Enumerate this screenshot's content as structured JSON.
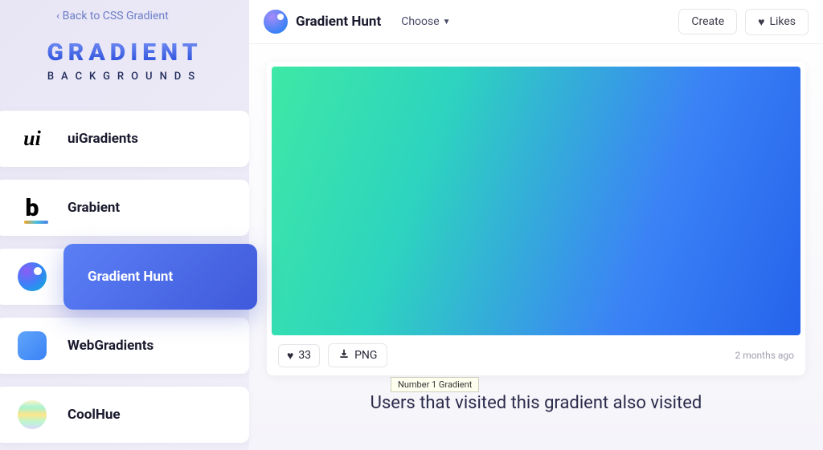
{
  "sidebar": {
    "back_link": "‹ Back to CSS Gradient",
    "logo_title": "GRADIENT",
    "logo_subtitle": "BACKGROUNDS",
    "sites": [
      {
        "label": "uiGradients"
      },
      {
        "label": "Grabient"
      },
      {
        "label": "Gradient Hunt",
        "active": true
      },
      {
        "label": "WebGradients"
      },
      {
        "label": "CoolHue"
      }
    ]
  },
  "topbar": {
    "brand": "Gradient Hunt",
    "choose_label": "Choose",
    "create_label": "Create",
    "likes_label": "Likes"
  },
  "card": {
    "like_count": "33",
    "png_label": "PNG",
    "time_ago": "2 months ago",
    "tooltip": "Number 1 Gradient"
  },
  "section_title": "Users that visited this gradient also visited"
}
